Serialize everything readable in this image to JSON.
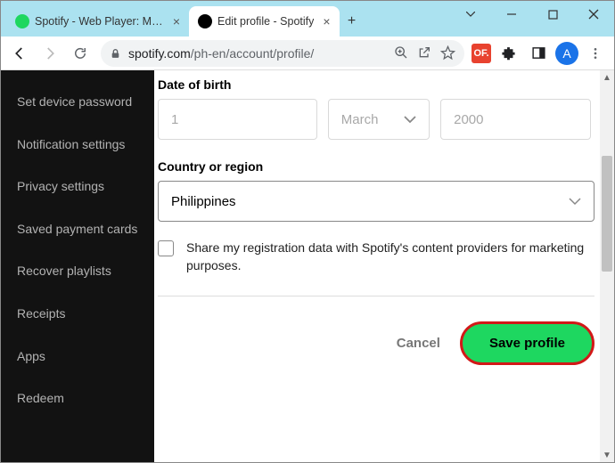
{
  "window": {
    "tabs": [
      {
        "title": "Spotify - Web Player: Music",
        "active": false
      },
      {
        "title": "Edit profile - Spotify",
        "active": true
      }
    ]
  },
  "toolbar": {
    "url_domain": "spotify.com",
    "url_path": "/ph-en/account/profile/",
    "avatar_initial": "A",
    "ext_label": "OF."
  },
  "sidebar": {
    "items": [
      "Set device password",
      "Notification settings",
      "Privacy settings",
      "Saved payment cards",
      "Recover playlists",
      "Receipts",
      "Apps",
      "Redeem"
    ]
  },
  "form": {
    "dob_label": "Date of birth",
    "dob_day": "1",
    "dob_month": "March",
    "dob_year": "2000",
    "country_label": "Country or region",
    "country_value": "Philippines",
    "consent_text": "Share my registration data with Spotify's content providers for marketing purposes.",
    "cancel_label": "Cancel",
    "save_label": "Save profile"
  }
}
